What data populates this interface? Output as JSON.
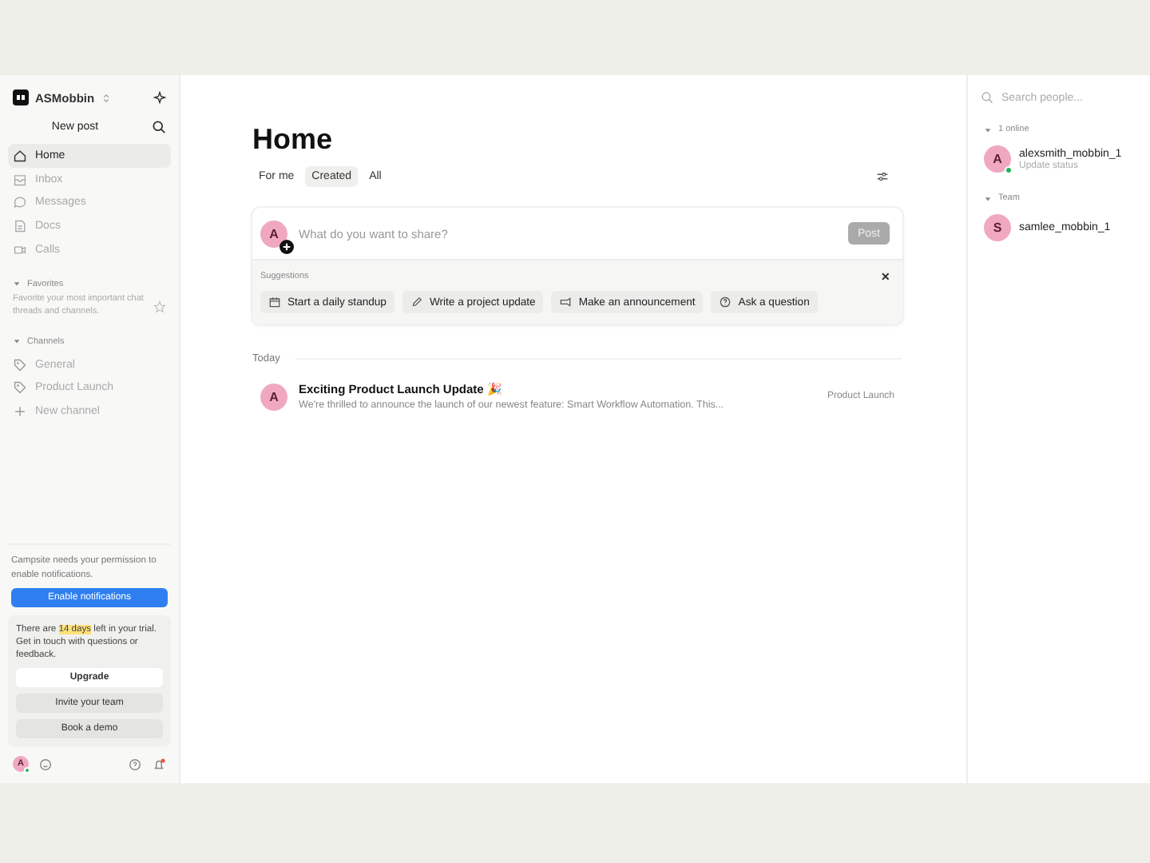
{
  "workspace": {
    "name": "ASMobbin"
  },
  "new_post": "New post",
  "nav": [
    {
      "label": "Home",
      "selected": true
    },
    {
      "label": "Inbox",
      "selected": false
    },
    {
      "label": "Messages",
      "selected": false
    },
    {
      "label": "Docs",
      "selected": false
    },
    {
      "label": "Calls",
      "selected": false
    }
  ],
  "favorites": {
    "heading": "Favorites",
    "expanded": true,
    "hint": "Favorite your most important chat threads and channels."
  },
  "channels": {
    "heading": "Channels",
    "expanded": true,
    "items": [
      "General",
      "Product Launch"
    ],
    "new": "New channel"
  },
  "notice": {
    "text": "Campsite needs your permission to enable notifications.",
    "button": "Enable notifications"
  },
  "trial": {
    "text": "There are **14 days** left in your trial. Get in touch with questions or feedback.",
    "buttons": [
      "Upgrade",
      "Invite your team",
      "Book a demo"
    ]
  },
  "footer": {
    "avatar": "A",
    "online": true
  },
  "main": {
    "title": "Home",
    "tabs": [
      {
        "label": "For me",
        "selected": false
      },
      {
        "label": "Created",
        "selected": true
      },
      {
        "label": "All",
        "selected": false
      }
    ],
    "composer": {
      "avatar": "A",
      "placeholder": "What do you want to share?",
      "post": "Post",
      "post_disabled": true
    },
    "suggestions": {
      "heading": "Suggestions",
      "close": "×",
      "chips": [
        "Start a daily standup",
        "Write a project update",
        "Make an announcement",
        "Ask a question"
      ]
    },
    "groups": [
      {
        "heading": "Today",
        "posts": [
          {
            "avatar": "A",
            "title": "Exciting Product Launch Update 🎉",
            "excerpt": "We're thrilled to announce the launch of our newest feature: Smart Workflow Automation. This...",
            "channel": "Product Launch"
          }
        ]
      }
    ]
  },
  "people": {
    "search_placeholder": "Search people...",
    "groups": [
      {
        "heading": "1 online",
        "expanded": true,
        "members": [
          {
            "avatar": "A",
            "name": "alexsmith_mobbin_1",
            "status": "Update status",
            "online": true
          }
        ]
      },
      {
        "heading": "Team",
        "expanded": true,
        "members": [
          {
            "avatar": "S",
            "name": "samlee_mobbin_1",
            "online": false
          }
        ]
      }
    ]
  }
}
